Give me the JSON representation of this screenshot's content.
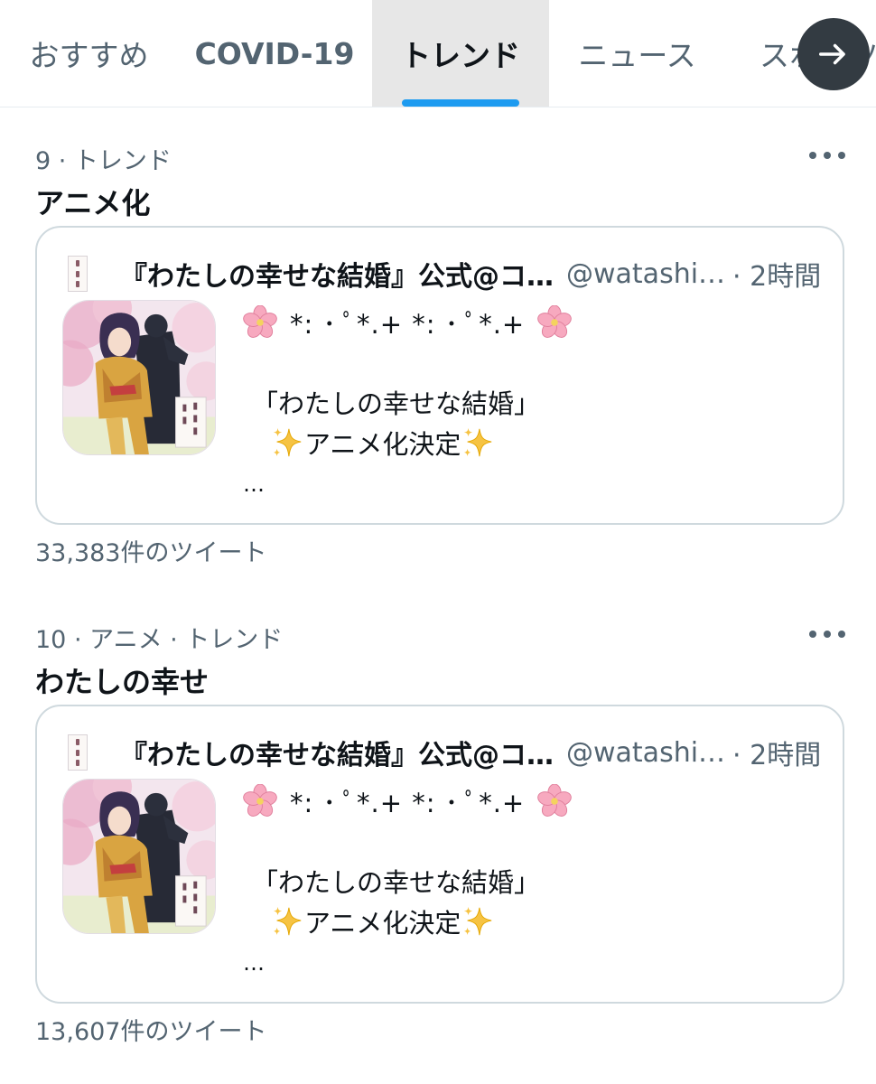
{
  "tabs": [
    {
      "label": "おすすめ",
      "active": false
    },
    {
      "label": "COVID-19",
      "active": false
    },
    {
      "label": "トレンド",
      "active": true
    },
    {
      "label": "ニュース",
      "active": false
    },
    {
      "label": "スポーツ",
      "active": false
    }
  ],
  "next_button_icon": "arrow-right-icon",
  "accent_color": "#1d9bf0",
  "trends": [
    {
      "meta": "9 · トレンド",
      "title": "アニメ化",
      "count": "33,383件のツイート",
      "card": {
        "name": "『わたしの幸せな結婚』公式@コ…",
        "handle": "@watashi…",
        "time": "· 2時間",
        "stars": "*: ･ ﾟ*.+ *: ･ ﾟ*.+",
        "quote": "「わたしの幸せな結婚」",
        "announce": "アニメ化決定",
        "ellipsis": "…"
      }
    },
    {
      "meta": "10 · アニメ · トレンド",
      "title": "わたしの幸せ",
      "count": "13,607件のツイート",
      "card": {
        "name": "『わたしの幸せな結婚』公式@コ…",
        "handle": "@watashi…",
        "time": "· 2時間",
        "stars": "*: ･ ﾟ*.+ *: ･ ﾟ*.+",
        "quote": "「わたしの幸せな結婚」",
        "announce": "アニメ化決定",
        "ellipsis": "…"
      }
    }
  ]
}
